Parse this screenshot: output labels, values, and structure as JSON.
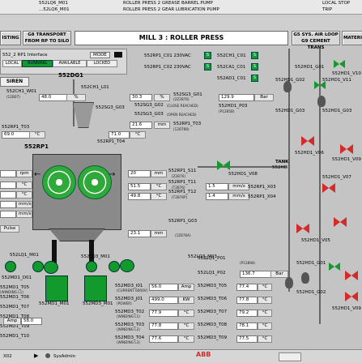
{
  "top_strip": {
    "line1": "552LQ6_M01",
    "line2": "...52LQ6_M01",
    "alarm1": "ROLLER PRESS 2 GREASE BARREL PUMP",
    "alarm2": "ROLLER PRESS 2 GEAR LUBRICATION PUMP",
    "status1": "LOCAL STOP",
    "status2": "TRIP"
  },
  "nav": {
    "left": "ISTING",
    "g8": "G8 TRANSPORT FROM RP TO SILO",
    "title": "MILL 3 : ROLLER PRESS",
    "g5": "G5 SYS. AIR LOOP G9 CEMENT TRANS",
    "right": "MATERI"
  },
  "interface": {
    "title": "552_2 RP1 Interface",
    "mode_label": "MODE",
    "states": [
      "LOCAL",
      "RUNNING",
      "AVAILABLE",
      "LOCKED"
    ],
    "siren": "SIREN"
  },
  "upper_tags": {
    "c01": "552RP1_C01 230VAC",
    "c02": "552RP1_C02 230VAC",
    "ch01": "552CH1_C01",
    "ca01": "552CA1_C01",
    "ad01": "552AD1_C01",
    "box": "S"
  },
  "dg": {
    "tag": "552DG1",
    "l01": "552CH1_L01",
    "w01": "552CH1_W01",
    "w01_sub": "(12B07)",
    "w01_val": "48.0",
    "w01_unit": "%",
    "g03": "552SG3_G03",
    "g03_val": "30.3",
    "g03_unit": "%"
  },
  "gates": {
    "g01": "552SG3_G01",
    "g01_sub": "(2Z2B76)",
    "g02": "552SG3_G02",
    "g02_sub": "(CLOSE REACHED)",
    "g03b": "552SG3_G03",
    "g03b_sub": "(OPEN REACHED)",
    "gap_val": "21.6",
    "gap_unit": "mm",
    "t03b": "552RP1_T03",
    "t03b_sub": "(12B7B6)",
    "t03b_val": "71.0",
    "t03b_unit": "°C"
  },
  "left_col": {
    "t03": "552RP1_T03",
    "t03_val": "69.0",
    "t03_unit": "°C",
    "rp1": "552RP1",
    "t04": "552RP1_T04",
    "rpm": "rpm",
    "c1": "°C",
    "c2": "°C",
    "mms1": "mm/s",
    "mms2": "mm/s",
    "pulse": "Pulse"
  },
  "center_right": {
    "s11": "552RP1_S11",
    "s11_sub": "(Z2B76)",
    "s11_val": "20",
    "s11_unit": "mm",
    "t11": "552RP1_T11",
    "t11_sub": "(T2B76)",
    "t11_val": "51.5",
    "t11_unit": "°C",
    "t12": "552RP1_T12",
    "t12_sub": "(T2B76P)",
    "t12_val": "49.8",
    "t12_unit": "°C",
    "x03": "552RP1_X03",
    "x03_val": "1.5",
    "x03_unit": "mm/s",
    "x04": "552RP1_X04",
    "x04_val": "1.4",
    "x04_unit": "mm/s",
    "g03": "552RP1_G03",
    "g03_val": "23.1",
    "g03_unit": "mm",
    "g03_sub": "(1Z876A)",
    "v08": "552HD1_V08",
    "tank": "TANK",
    "tank2": "552HD1"
  },
  "hydraulic": {
    "g01": "552HD1_G01",
    "g02": "552HD1_G02",
    "v10": "552HD1_V10",
    "v11": "552HD1_V11",
    "p03": "552HD1_P03",
    "p03_sub": "(P12B5B)",
    "p03_val": "129.9",
    "p03_unit": "Bar",
    "g03": "552HD1_G03",
    "v06": "552HD1_V06",
    "v09": "552HD1_V09",
    "v07": "552HD1_V07",
    "v05": "552HD1_V05",
    "p02": "552HD1_P02",
    "p02_sub": "(P12B9A)",
    "p02_val": "136.7",
    "p02_unit": "Bar",
    "g01b": "552HD1_G01",
    "g02b": "552HD1_G02",
    "v09b": "552HD1_V09"
  },
  "bottom_left": {
    "q01": "552LQ1_M01",
    "d01": "552MD1_D01",
    "t05": "552MD1_T05",
    "t06": "552MD1_T06",
    "t07": "552MD1_T07",
    "t08": "552MD1_T08",
    "t09": "552MD1_T09",
    "t10": "552MD1_T10",
    "sub": "(WINDING L1)",
    "m01": "552MD1_M01",
    "m02": "552MD3_M01",
    "q03": "552LQ3_M01",
    "q03b": "552LQ3_M03"
  },
  "motor_table": {
    "rows": [
      {
        "tag": "552MD3_I01",
        "sub": "(CURRENT 6000V)",
        "val": "56.0",
        "unit": "Amp",
        "tag2": "552MD3_T05",
        "val2": "77.4",
        "unit2": "°C"
      },
      {
        "tag": "552MD3_J01",
        "sub": "(POWER)",
        "val": "499.0",
        "unit": "KW",
        "tag2": "552MD3_T06",
        "val2": "77.8",
        "unit2": "°C"
      },
      {
        "tag": "552MD3_T02",
        "sub": "(WINDING L1)",
        "val": "77.9",
        "unit": "°C",
        "tag2": "552MD3_T07",
        "val2": "79.2",
        "unit2": "°C"
      },
      {
        "tag": "552MD3_T03",
        "sub": "(WINDING L2)",
        "val": "77.8",
        "unit": "°C",
        "tag2": "552MD3_T08",
        "val2": "78.1",
        "unit2": "°C"
      },
      {
        "tag": "552MD3_T04",
        "sub": "(WINDING L3)",
        "val": "77.6",
        "unit": "°C",
        "tag2": "552MD3_T09",
        "val2": "77.5",
        "unit2": "°C"
      }
    ],
    "left_val": "58.0",
    "left_unit": "Amp"
  },
  "right_bottom": {
    "lq01": "552LQ1_P01",
    "lq01_sub": "(P12B94)",
    "lq02": "552LQ1_P02",
    "lq02_val": "136.7",
    "lq02_unit": "Bar",
    "g01": "552HD1_G01",
    "g02": "552HD1_G02"
  },
  "taskbar": {
    "items": [
      "X02",
      "SysAdmin"
    ],
    "brand": "ABB"
  },
  "colors": {
    "green": "#129a2c",
    "red": "#d42a2a",
    "roller": "#2faa3a",
    "housing": "#8a8a8a",
    "title_bg": "#ffffff"
  }
}
